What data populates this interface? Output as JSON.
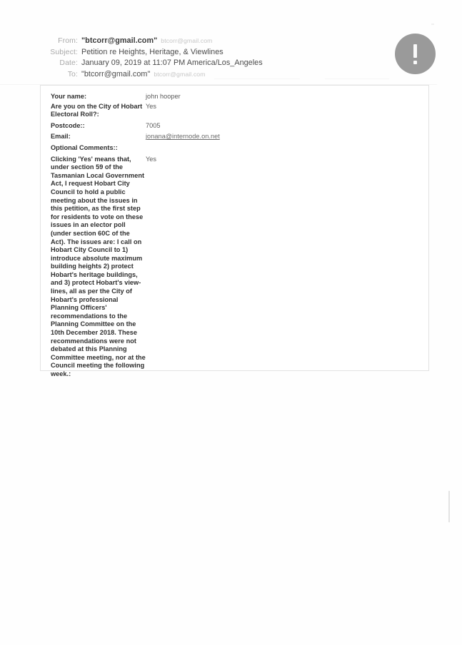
{
  "email_header": {
    "rows": [
      {
        "label": "From:",
        "value": "\"btcorr@gmail.com\"",
        "sub": "btcorr@gmail.com",
        "bold": true
      },
      {
        "label": "Subject:",
        "value": "Petition re Heights, Heritage, & Viewlines",
        "sub": "",
        "bold": false
      },
      {
        "label": "Date:",
        "value": "January 09, 2019 at 11:07 PM America/Los_Angeles",
        "sub": "",
        "bold": false
      },
      {
        "label": "To:",
        "value": "\"btcorr@gmail.com\"",
        "sub": "btcorr@gmail.com",
        "bold": false
      }
    ]
  },
  "avatar": {
    "icon": "exclamation-mark-icon",
    "color": "#9a9a9a"
  },
  "form": {
    "rows": [
      {
        "label": "Your name:",
        "value": "john hooper",
        "link": false
      },
      {
        "label": "Are you on the City of Hobart Electoral Roll?:",
        "value": "Yes",
        "link": false
      },
      {
        "label": "Postcode::",
        "value": "7005",
        "link": false
      },
      {
        "label": "Email:",
        "value": "jonana@internode.on.net",
        "link": true
      },
      {
        "label": "Optional Comments::",
        "value": "",
        "link": false
      }
    ],
    "comment": {
      "text": "Clicking 'Yes' means that, under section 59 of the Tasmanian Local Government Act, I request Hobart City Council to hold a public meeting about the issues in this petition, as the first step for residents to vote on these issues in an elector poll (under section 60C of the Act). The issues are: I call on Hobart City Council to 1) introduce absolute maximum building heights 2) protect Hobart's heritage buildings, and 3) protect Hobart's view-lines, all as per the City of Hobart's professional Planning Officers' recommendations to the Planning Committee on the 10th December 2018. These recommendations were not debated at this Planning Committee meeting, nor at the Council meeting the following week.:",
      "answer": "Yes"
    }
  }
}
